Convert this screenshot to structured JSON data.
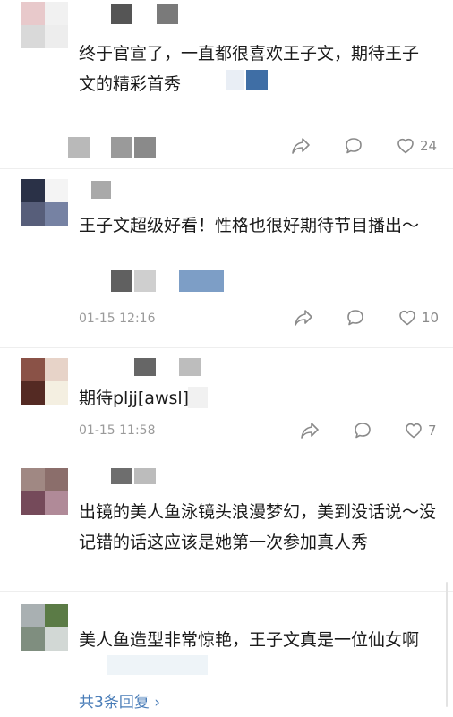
{
  "comments": [
    {
      "text": "终于官宣了，一直都很喜欢王子文，期待王子文的精彩首秀",
      "time": "",
      "likes": "24",
      "avatar_colors": [
        "#e8c9cb",
        "#f1f1f1",
        "#d9d9d9",
        "#ededed"
      ]
    },
    {
      "text": "王子文超级好看！性格也很好期待节目播出～",
      "time": "01-15 12:16",
      "likes": "10",
      "avatar_colors": [
        "#2a3147",
        "#f4f4f4",
        "#575e7a",
        "#7682a3"
      ]
    },
    {
      "text": "期待pljj[awsl]",
      "time": "01-15 11:58",
      "likes": "7",
      "avatar_colors": [
        "#8a5247",
        "#e7d3c8",
        "#542a23",
        "#f4efe1"
      ]
    },
    {
      "text": "出镜的美人鱼泳镜头浪漫梦幻，美到没话说～没记错的话这应该是她第一次参加真人秀",
      "time": "",
      "likes": "",
      "avatar_colors": [
        "#a08883",
        "#8b6e6b",
        "#754a5a",
        "#b08a98"
      ]
    },
    {
      "text": "美人鱼造型非常惊艳，王子文真是一位仙女啊",
      "time": "",
      "likes": "",
      "avatar_colors": [
        "#a9b0b2",
        "#5b7b46",
        "#7f8e7f",
        "#d2d8d5"
      ],
      "replies_label": "共3条回复 ›"
    }
  ],
  "icons": [
    "share-icon",
    "comment-icon",
    "heart-icon"
  ],
  "colors": {
    "link": "#4a7db8",
    "meta": "#9a9a9a",
    "text": "#1a1a1a"
  }
}
